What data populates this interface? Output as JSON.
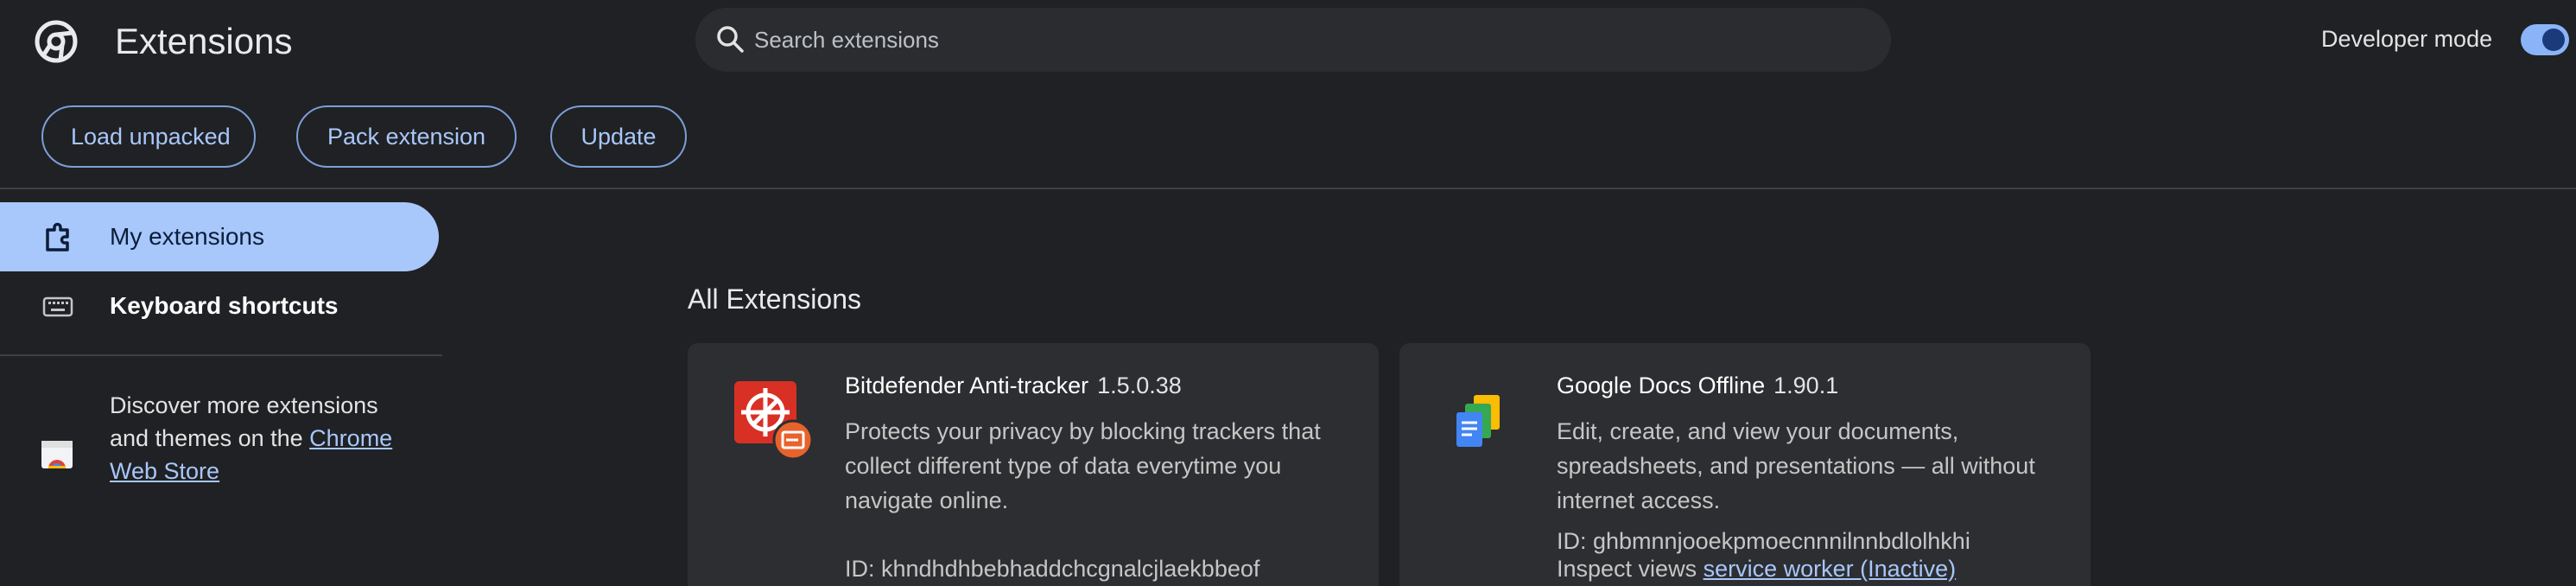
{
  "header": {
    "title": "Extensions",
    "search_placeholder": "Search extensions",
    "developer_mode_label": "Developer mode",
    "developer_mode_on": true
  },
  "toolbar": {
    "load_unpacked": "Load unpacked",
    "pack_extension": "Pack extension",
    "update": "Update"
  },
  "sidebar": {
    "items": [
      {
        "label": "My extensions",
        "icon": "puzzle-icon",
        "active": true
      },
      {
        "label": "Keyboard shortcuts",
        "icon": "keyboard-icon",
        "active": false
      }
    ],
    "promo_text": "Discover more extensions and themes on the ",
    "promo_link": "Chrome Web Store"
  },
  "main": {
    "section_title": "All Extensions",
    "extensions": [
      {
        "name": "Bitdefender Anti-tracker",
        "version": "1.5.0.38",
        "description": "Protects your privacy by blocking trackers that collect different type of data everytime you navigate online.",
        "id": "ID: khndhdhbebhaddchcgnalcjlaekbbeof",
        "icon": "bitdefender-icon"
      },
      {
        "name": "Google Docs Offline",
        "version": "1.90.1",
        "description": "Edit, create, and view your documents, spreadsheets, and presentations — all without internet access.",
        "id": "ID: ghbmnnjooekpmoecnnnilnnbdlolhkhi",
        "inspect_label": "Inspect views ",
        "inspect_link": "service worker (Inactive)",
        "icon": "google-docs-icon"
      }
    ]
  },
  "colors": {
    "background": "#202124",
    "accent": "#a8c7fa",
    "card": "#2d2e31"
  }
}
